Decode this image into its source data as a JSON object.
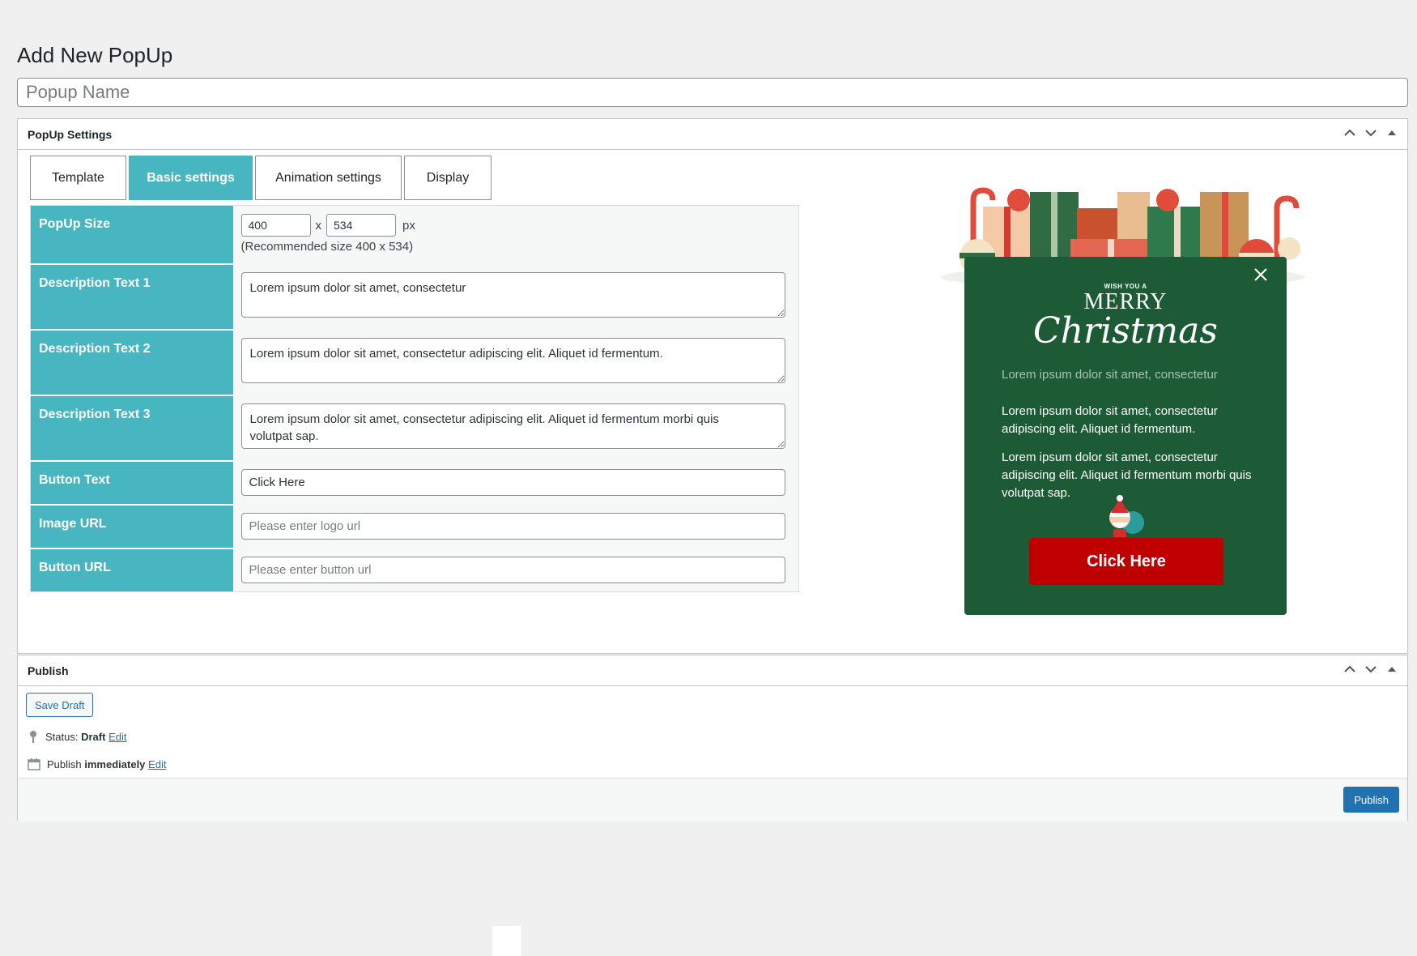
{
  "page": {
    "title": "Add New PopUp",
    "name_placeholder": "Popup Name"
  },
  "settings_box": {
    "title": "PopUp Settings",
    "tabs": [
      {
        "label": "Template",
        "active": false
      },
      {
        "label": "Basic settings",
        "active": true
      },
      {
        "label": "Animation settings",
        "active": false
      },
      {
        "label": "Display",
        "active": false
      }
    ],
    "fields": {
      "size": {
        "label": "PopUp Size",
        "width": "400",
        "height": "534",
        "sep": "x",
        "unit": "px",
        "note": "(Recommended size 400 x 534)"
      },
      "desc1": {
        "label": "Description Text 1",
        "value": "Lorem ipsum dolor sit amet, consectetur"
      },
      "desc2": {
        "label": "Description Text 2",
        "value": "Lorem ipsum dolor sit amet, consectetur adipiscing elit. Aliquet id fermentum."
      },
      "desc3": {
        "label": "Description Text 3",
        "value": "Lorem ipsum dolor sit amet, consectetur adipiscing elit. Aliquet id fermentum morbi quis\nvolutpat sap."
      },
      "button_text": {
        "label": "Button Text",
        "value": "Click Here"
      },
      "image_url": {
        "label": "Image URL",
        "placeholder": "Please enter logo url"
      },
      "button_url": {
        "label": "Button URL",
        "placeholder": "Please enter button url"
      }
    }
  },
  "preview": {
    "wish": "WISH YOU A",
    "merry": "MERRY",
    "christmas": "Christmas",
    "text1": "Lorem ipsum dolor sit amet, consectetur",
    "text2": "Lorem ipsum dolor sit amet, consectetur adipiscing elit. Aliquet id fermentum.",
    "text3_line1": "Lorem ipsum dolor sit amet, consectetur adipiscing elit. Aliquet id fermentum morbi quis",
    "text3_line2": "volutpat sap.",
    "button": "Click Here",
    "colors": {
      "background": "#1d5b37",
      "button": "#c00000"
    }
  },
  "publish_box": {
    "title": "Publish",
    "save_draft": "Save Draft",
    "status_label": "Status:",
    "status_value": "Draft",
    "edit": "Edit",
    "publish_label": "Publish",
    "publish_value": "immediately",
    "publish_button": "Publish"
  },
  "colors": {
    "accent": "#48b6c0",
    "primary": "#2271b1"
  }
}
